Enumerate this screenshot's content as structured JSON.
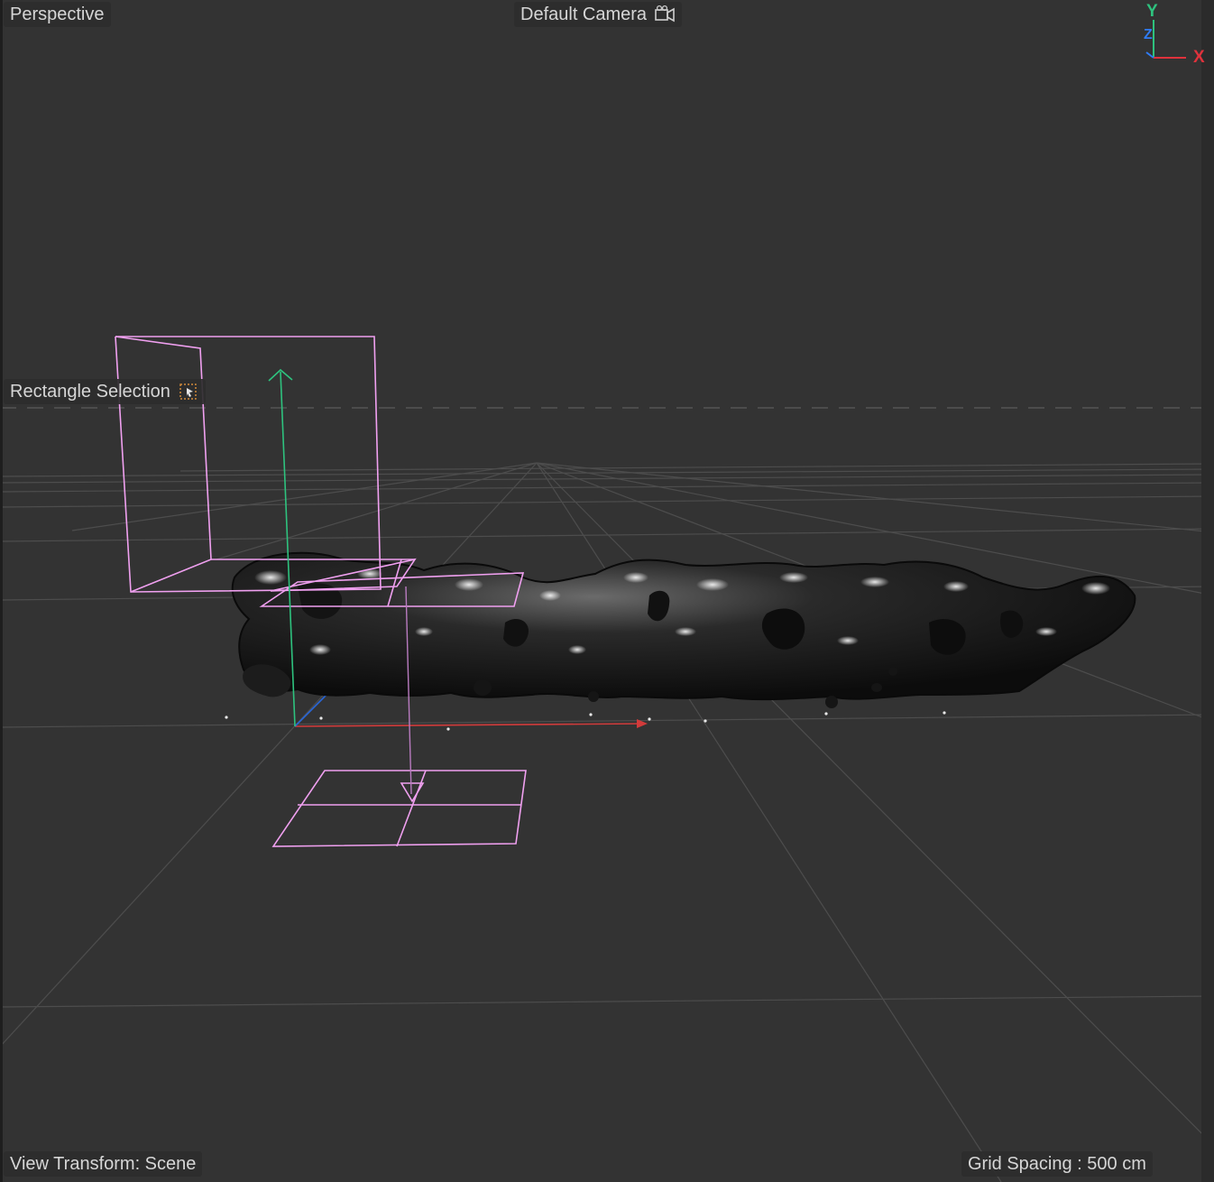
{
  "viewport": {
    "projection_label": "Perspective",
    "camera_label": "Default Camera",
    "camera_icon": "camera-icon",
    "selection_tool_label": "Rectangle Selection",
    "selection_tool_icon": "rectangle-selection-icon",
    "view_transform_label": "View Transform: Scene",
    "grid_spacing_label": "Grid Spacing : 500 cm"
  },
  "axis_gizmo": {
    "y_label": "Y",
    "z_label": "Z",
    "x_label": "X",
    "y_color": "#2ec27e",
    "z_color": "#2f7cf6",
    "x_color": "#e0323c"
  },
  "colors": {
    "background": "#333333",
    "grid": "#4a4a4a",
    "selection_wireframe": "#f0a0f0",
    "object_material": "#1a1a1a"
  }
}
